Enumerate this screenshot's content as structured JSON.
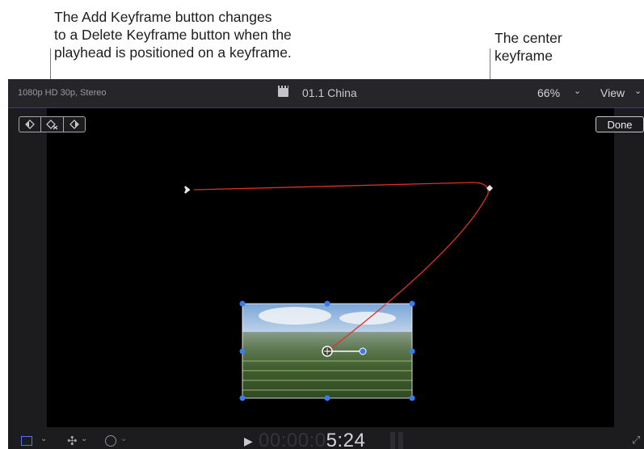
{
  "callouts": {
    "left": {
      "line1": "The Add Keyframe button changes",
      "line2": "to a Delete Keyframe button when the",
      "line3": "playhead is positioned on a keyframe."
    },
    "right": {
      "line1": "The center",
      "line2": "keyframe"
    }
  },
  "viewer": {
    "format": "1080p HD 30p, Stereo",
    "clip_icon": "clapperboard-icon",
    "clip_name": "01.1 China",
    "zoom": "66%",
    "zoom_chevron": "⌄",
    "view_menu": "View",
    "view_chevron": "⌄",
    "done_label": "Done",
    "keyframe_controls": {
      "previous": "previous-keyframe-icon",
      "delete": "delete-keyframe-icon",
      "next": "next-keyframe-icon"
    }
  },
  "motion_path": {
    "color": "#e0302a",
    "keyframe_color": "#e6e6e6",
    "handle_color": "#3a7bf2"
  },
  "timeline": {
    "timecode_dim": "00:00:0",
    "timecode_bright": "5:24",
    "play_icon": "▶",
    "transform_chevron": "⌄",
    "enhance_icon": "✣",
    "enhance_chevron": "⌄",
    "speed_chevron": "⌄",
    "fullscreen_icon": "⤢"
  }
}
